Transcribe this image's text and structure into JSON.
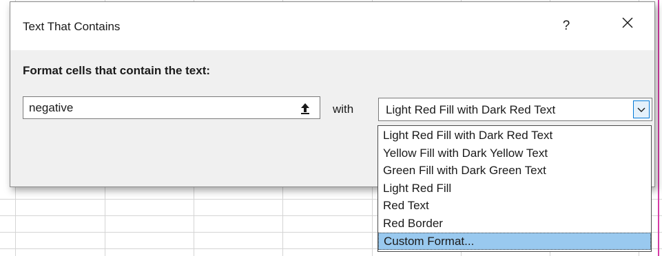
{
  "dialog": {
    "title": "Text That Contains",
    "help_label": "?",
    "close_icon": "close-icon",
    "instruction": "Format cells that contain the text:",
    "text_value": "negative",
    "ref_icon": "collapse-dialog-arrow-icon",
    "with_label": "with",
    "format_selected": "Light Red Fill with Dark Red Text",
    "dropdown_icon": "chevron-down-icon"
  },
  "dropdown": {
    "options": [
      "Light Red Fill with Dark Red Text",
      "Yellow Fill with Dark Yellow Text",
      "Green Fill with Dark Green Text",
      "Light Red Fill",
      "Red Text",
      "Red Border",
      "Custom Format..."
    ],
    "highlighted": "Custom Format..."
  },
  "colors": {
    "dialog_bg": "#f0f0f0",
    "highlight": "#99c9ef",
    "accent": "#0078d7",
    "window_edge": "#d63aa6"
  }
}
